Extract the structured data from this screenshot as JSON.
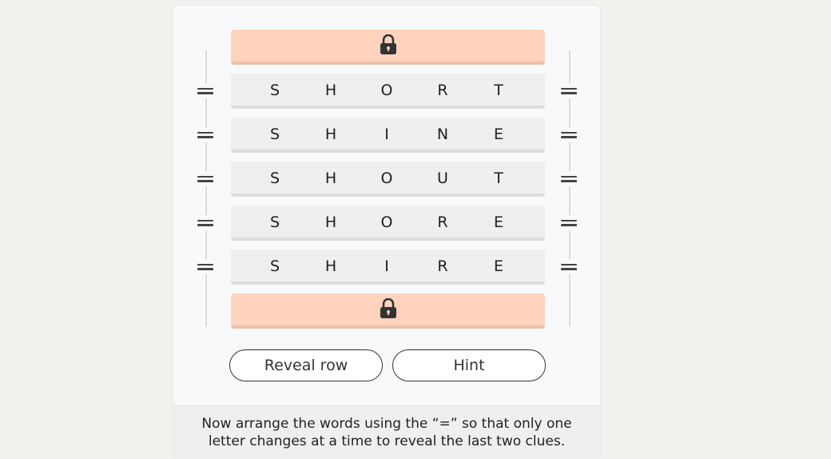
{
  "rows": [
    {
      "letters": [
        "S",
        "H",
        "O",
        "R",
        "T"
      ]
    },
    {
      "letters": [
        "S",
        "H",
        "I",
        "N",
        "E"
      ]
    },
    {
      "letters": [
        "S",
        "H",
        "O",
        "U",
        "T"
      ]
    },
    {
      "letters": [
        "S",
        "H",
        "O",
        "R",
        "E"
      ]
    },
    {
      "letters": [
        "S",
        "H",
        "I",
        "R",
        "E"
      ]
    }
  ],
  "icons": {
    "lock": "lock-icon",
    "drag": "drag-handle-icon"
  },
  "colors": {
    "locked_row": "#ffd3bd",
    "word_row": "#efefef",
    "background": "#f2f1ee"
  },
  "buttons": {
    "reveal_row": "Reveal row",
    "hint": "Hint"
  },
  "instructions": {
    "line1": "Now arrange the words using the “=” so that only one",
    "line2": "letter changes at a time to reveal the last two clues."
  }
}
